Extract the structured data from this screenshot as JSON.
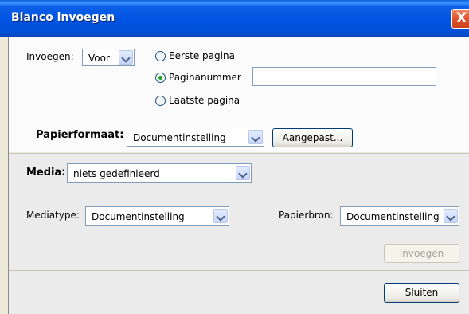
{
  "window": {
    "title": "Blanco invoegen",
    "close_label": "X"
  },
  "insert": {
    "label": "Invoegen:",
    "position_value": "Voor",
    "options": [
      {
        "label": "Eerste pagina",
        "checked": false
      },
      {
        "label": "Paginanummer",
        "checked": true
      },
      {
        "label": "Laatste pagina",
        "checked": false
      }
    ],
    "page_number_value": ""
  },
  "paper": {
    "label": "Papierformaat:",
    "value": "Documentinstelling",
    "custom_button": "Aangepast..."
  },
  "media": {
    "label": "Media:",
    "value": "niets gedefinieerd",
    "type_label": "Mediatype:",
    "type_value": "Documentinstelling",
    "source_label": "Papierbron:",
    "source_value": "Documentinstelling"
  },
  "buttons": {
    "insert": "Invoegen",
    "close": "Sluiten"
  }
}
